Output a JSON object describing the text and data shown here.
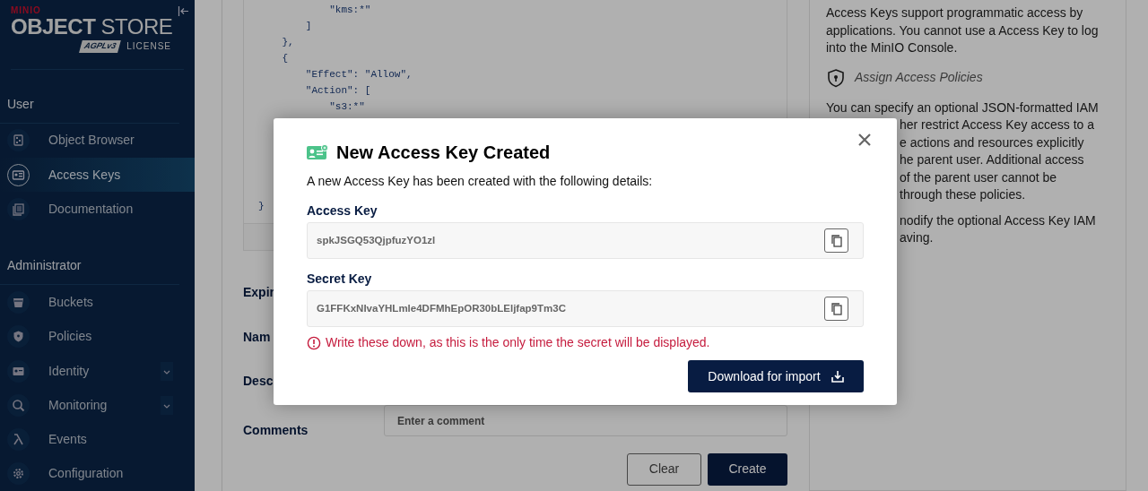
{
  "sidebar": {
    "logo": {
      "brand": "MINIO",
      "product_bold": "OBJECT",
      "product_light": "STORE",
      "badge": "AGPLv3",
      "license": "LICENSE"
    },
    "sections": [
      {
        "title": "User",
        "items": [
          {
            "label": "Object Browser",
            "selected": false,
            "expandable": false
          },
          {
            "label": "Access Keys",
            "selected": true,
            "expandable": false
          },
          {
            "label": "Documentation",
            "selected": false,
            "expandable": false
          }
        ]
      },
      {
        "title": "Administrator",
        "items": [
          {
            "label": "Buckets",
            "selected": false,
            "expandable": false
          },
          {
            "label": "Policies",
            "selected": false,
            "expandable": false
          },
          {
            "label": "Identity",
            "selected": false,
            "expandable": true
          },
          {
            "label": "Monitoring",
            "selected": false,
            "expandable": true
          },
          {
            "label": "Events",
            "selected": false,
            "expandable": false
          },
          {
            "label": "Configuration",
            "selected": false,
            "expandable": false
          }
        ]
      }
    ]
  },
  "editor": {
    "lines_top": [
      "            \"kms:*\"",
      "        ]",
      "    },",
      "    {",
      "        \"Effect\": \"Allow\",",
      "        \"Action\": [",
      "            \"s3:*\""
    ],
    "lines_bottom": [
      "}"
    ]
  },
  "form": {
    "labels": [
      "Expir",
      "Nam",
      "Desc"
    ],
    "comments": {
      "label": "Comments",
      "placeholder": "Enter a comment"
    },
    "buttons": [
      {
        "label": "Clear",
        "kind": "outline"
      },
      {
        "label": "Create",
        "kind": "primary"
      }
    ]
  },
  "help": {
    "intro": "Access Keys support programmatic access by applications. You cannot use a Access Key to log into the MinIO Console.",
    "heading": "Assign Access Policies",
    "first_line": "You can specify an optional JSON-formatted IAM",
    "partial_lines": [
      "her restrict Access Key access to a",
      "e actions and resources explicitly",
      "he parent user. Additional access",
      "of the parent user cannot be",
      "through these policies."
    ],
    "partial_lines_2": [
      "nodify the optional Access Key IAM",
      "aving."
    ]
  },
  "modal": {
    "title": "New Access Key Created",
    "description": "A new Access Key has been created with the following details:",
    "fields": [
      {
        "label": "Access Key",
        "value": "spkJSGQ53QjpfuzYO1zl"
      },
      {
        "label": "Secret Key",
        "value": "G1FFKxNIvaYHLmle4DFMhEpOR30bLEljfap9Tm3C"
      }
    ],
    "warning": "Write these down, as this is the only time the secret will be displayed.",
    "download_button": "Download for import"
  }
}
